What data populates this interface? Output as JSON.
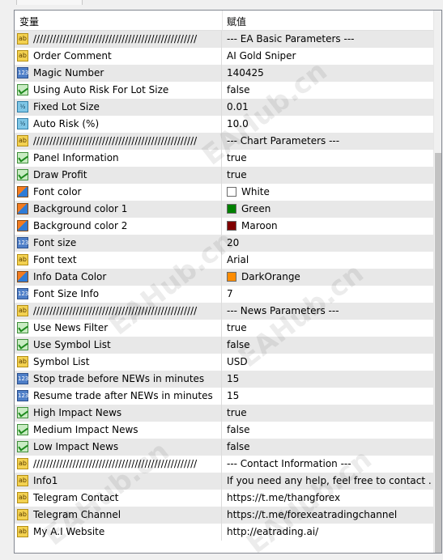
{
  "header": {
    "col_name": "变量",
    "col_value": "赋值"
  },
  "rows": [
    {
      "icon": "ab",
      "name": "//////////////////////////////////////////////////",
      "value": "--- EA Basic Parameters ---"
    },
    {
      "icon": "ab",
      "name": "Order Comment",
      "value": "AI Gold Sniper"
    },
    {
      "icon": "num",
      "name": "Magic Number",
      "value": "140425"
    },
    {
      "icon": "bool",
      "name": "Using Auto Risk For Lot Size",
      "value": "false"
    },
    {
      "icon": "dbl",
      "name": "Fixed Lot Size",
      "value": "0.01"
    },
    {
      "icon": "dbl",
      "name": "Auto Risk (%)",
      "value": "10.0"
    },
    {
      "icon": "ab",
      "name": "//////////////////////////////////////////////////",
      "value": "--- Chart Parameters ---"
    },
    {
      "icon": "bool",
      "name": "Panel Information",
      "value": "true"
    },
    {
      "icon": "bool",
      "name": "Draw Profit",
      "value": "true"
    },
    {
      "icon": "color",
      "name": "Font color",
      "value": "White",
      "swatch": "#ffffff"
    },
    {
      "icon": "color",
      "name": "Background color 1",
      "value": "Green",
      "swatch": "#008000"
    },
    {
      "icon": "color",
      "name": "Background color 2",
      "value": "Maroon",
      "swatch": "#800000"
    },
    {
      "icon": "num",
      "name": "Font size",
      "value": "20"
    },
    {
      "icon": "ab",
      "name": "Font text",
      "value": "Arial"
    },
    {
      "icon": "color",
      "name": "Info Data Color",
      "value": "DarkOrange",
      "swatch": "#ff8c00"
    },
    {
      "icon": "num",
      "name": "Font Size Info",
      "value": "7"
    },
    {
      "icon": "ab",
      "name": "//////////////////////////////////////////////////",
      "value": "--- News Parameters ---"
    },
    {
      "icon": "bool",
      "name": "Use News Filter",
      "value": "true"
    },
    {
      "icon": "bool",
      "name": "Use Symbol List",
      "value": "false"
    },
    {
      "icon": "ab",
      "name": "Symbol List",
      "value": "USD"
    },
    {
      "icon": "num",
      "name": "Stop trade before NEWs in minutes",
      "value": "15"
    },
    {
      "icon": "num",
      "name": "Resume trade after NEWs in minutes",
      "value": "15"
    },
    {
      "icon": "bool",
      "name": "High Impact News",
      "value": "true"
    },
    {
      "icon": "bool",
      "name": "Medium Impact News",
      "value": "false"
    },
    {
      "icon": "bool",
      "name": "Low Impact News",
      "value": "false"
    },
    {
      "icon": "ab",
      "name": "//////////////////////////////////////////////////",
      "value": "--- Contact Information ---"
    },
    {
      "icon": "ab",
      "name": "Info1",
      "value": "If you need any help, feel free to contact ..."
    },
    {
      "icon": "ab",
      "name": "Telegram Contact",
      "value": "https://t.me/thangforex"
    },
    {
      "icon": "ab",
      "name": "Telegram Channel",
      "value": "https://t.me/forexeatradingchannel"
    },
    {
      "icon": "ab",
      "name": "My A.I Website",
      "value": "http://eatrading.ai/"
    }
  ],
  "watermark": "EAHub.cn"
}
